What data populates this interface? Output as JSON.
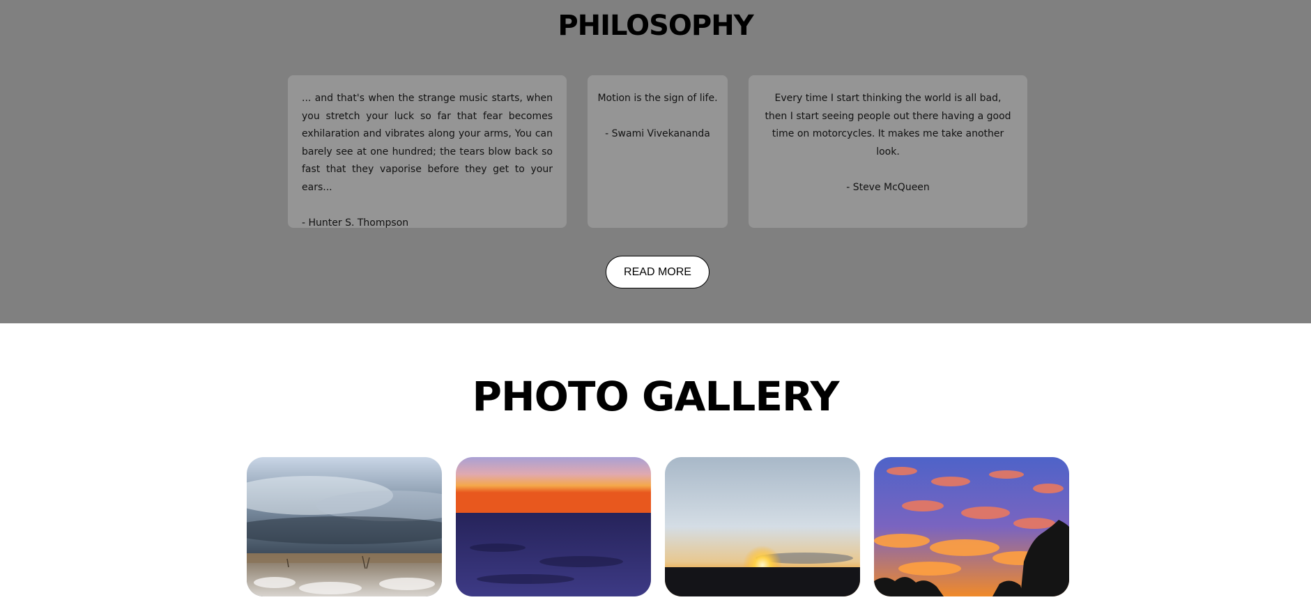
{
  "philosophy": {
    "title": "PHILOSOPHY",
    "quotes": [
      {
        "text": "... and that's when the strange music starts, when you stretch your luck so far that fear becomes exhilaration and vibrates along your arms, You can barely see at one hundred; the tears blow back so fast that they vaporise before they get to your ears...",
        "author": "- Hunter S. Thompson"
      },
      {
        "text": "Motion is the sign of life.",
        "author": "- Swami Vivekananda"
      },
      {
        "text": "Every time I start thinking the world is all bad, then I start seeing people out there having a good time on motorcycles. It makes me take another look.",
        "author": "- Steve McQueen"
      }
    ],
    "button_label": "READ MORE",
    "background_color": "#808080"
  },
  "gallery": {
    "title": "PHOTO GALLERY",
    "photos": [
      {
        "subject": "storm-clouds-over-snowy-prairie"
      },
      {
        "subject": "sunset-horizon-over-dark-field"
      },
      {
        "subject": "sun-setting-on-horizon"
      },
      {
        "subject": "fiery-cloud-sunset-with-trees"
      }
    ]
  }
}
